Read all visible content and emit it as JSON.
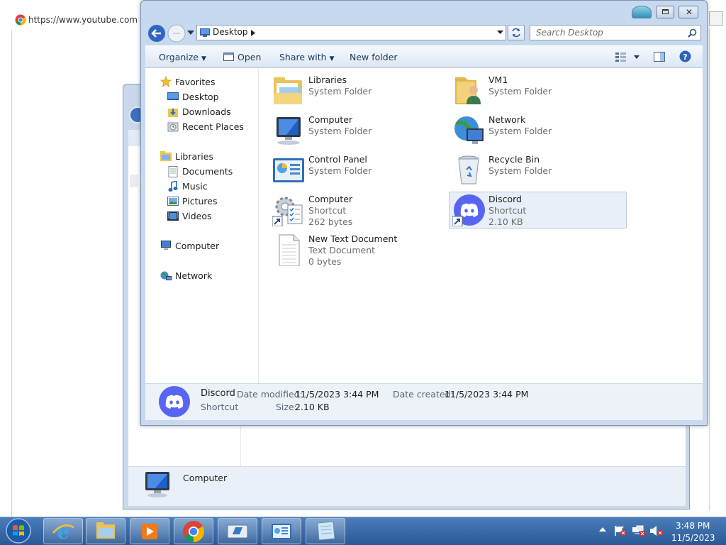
{
  "browser": {
    "url": "https://www.youtube.com - G"
  },
  "back_window": {
    "selected_name": "Computer"
  },
  "window": {
    "address": {
      "location": "Desktop"
    },
    "search": {
      "placeholder": "Search Desktop"
    },
    "toolbar": {
      "organize": "Organize",
      "open": "Open",
      "share_with": "Share with",
      "new_folder": "New folder"
    },
    "nav": {
      "favorites": {
        "label": "Favorites",
        "items": [
          "Desktop",
          "Downloads",
          "Recent Places"
        ]
      },
      "libraries": {
        "label": "Libraries",
        "items": [
          "Documents",
          "Music",
          "Pictures",
          "Videos"
        ]
      },
      "computer": "Computer",
      "network": "Network"
    },
    "items": [
      {
        "name": "Libraries",
        "line1": "System Folder",
        "line2": ""
      },
      {
        "name": "VM1",
        "line1": "System Folder",
        "line2": ""
      },
      {
        "name": "Computer",
        "line1": "System Folder",
        "line2": ""
      },
      {
        "name": "Network",
        "line1": "System Folder",
        "line2": ""
      },
      {
        "name": "Control Panel",
        "line1": "System Folder",
        "line2": ""
      },
      {
        "name": "Recycle Bin",
        "line1": "System Folder",
        "line2": ""
      },
      {
        "name": "Computer",
        "line1": "Shortcut",
        "line2": "262 bytes"
      },
      {
        "name": "Discord",
        "line1": "Shortcut",
        "line2": "2.10 KB"
      },
      {
        "name": "New Text Document",
        "line1": "Text Document",
        "line2": "0 bytes"
      }
    ],
    "details": {
      "name": "Discord",
      "type": "Shortcut",
      "modified_label": "Date modified:",
      "modified": "11/5/2023 3:44 PM",
      "created_label": "Date created:",
      "created": "11/5/2023 3:44 PM",
      "size_label": "Size:",
      "size": "2.10 KB"
    }
  },
  "taskbar": {
    "time": "3:48 PM",
    "date": "11/5/2023"
  },
  "colors": {
    "discord": "#5865F2",
    "taskbar": "#2a5a96",
    "window_frame": "#c6d9ee"
  }
}
